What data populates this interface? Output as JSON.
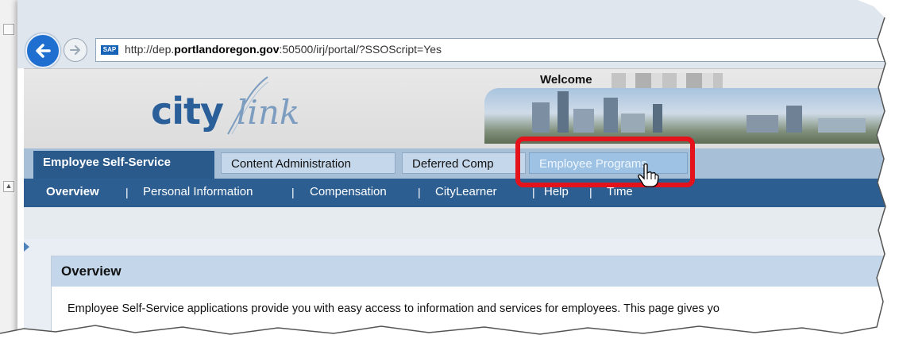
{
  "browser": {
    "url_prefix": "http://dep.",
    "url_domain": "portlandoregon.gov",
    "url_suffix": ":50500/irj/portal/?SSOScript=Yes",
    "site_icon_label": "SAP",
    "back_icon": "back-arrow-icon",
    "forward_icon": "forward-arrow-icon"
  },
  "header": {
    "logo_city": "city",
    "logo_link": "link",
    "welcome_label": "Welcome"
  },
  "tabs": [
    {
      "label": "Employee Self-Service",
      "state": "active"
    },
    {
      "label": "Content Administration",
      "state": "normal"
    },
    {
      "label": "Deferred Comp",
      "state": "normal"
    },
    {
      "label": "Employee Programs",
      "state": "hover"
    }
  ],
  "subnav": [
    {
      "label": "Overview"
    },
    {
      "label": "Personal Information"
    },
    {
      "label": "Compensation"
    },
    {
      "label": "CityLearner"
    },
    {
      "label": "Help"
    },
    {
      "label": "Time"
    }
  ],
  "subnav_separator": "|",
  "overview": {
    "title": "Overview",
    "text": "Employee Self-Service applications provide you with easy access to information and services for employees.  This page gives yo"
  },
  "colors": {
    "highlight": "#e3121b",
    "active_tab": "#2a5a8c",
    "subnav": "#2c5e92"
  }
}
